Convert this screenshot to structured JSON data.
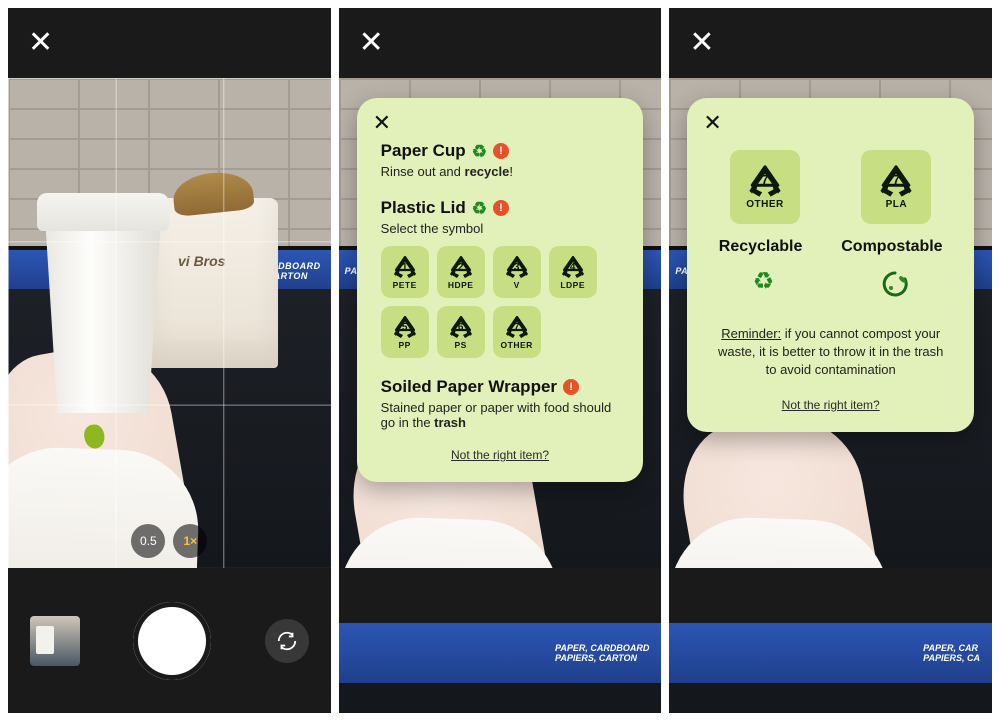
{
  "screen1": {
    "bagLogo": "vi Bros",
    "binLabelLine1": "PAPER, CARDBOARD",
    "binLabelLine2": "PAPIERS, CARTON",
    "zoom": {
      "level1": "0.5",
      "level2": "1×"
    }
  },
  "screen2": {
    "binLabel": "PAPER, CARD",
    "items": [
      {
        "title": "Paper Cup",
        "hasRecycle": true,
        "hasAlert": true,
        "sub_pre": "Rinse out and ",
        "sub_bold": "recycle",
        "sub_post": "!"
      },
      {
        "title": "Plastic Lid",
        "hasRecycle": true,
        "hasAlert": true,
        "sub_pre": "Select the symbol",
        "sub_bold": "",
        "sub_post": ""
      },
      {
        "title": "Soiled Paper Wrapper",
        "hasRecycle": false,
        "hasAlert": true,
        "sub_pre": "Stained paper or paper with food should go in the ",
        "sub_bold": "trash",
        "sub_post": ""
      }
    ],
    "symbols": [
      {
        "num": "1",
        "code": "PETE"
      },
      {
        "num": "2",
        "code": "HDPE"
      },
      {
        "num": "3",
        "code": "V"
      },
      {
        "num": "4",
        "code": "LDPE"
      },
      {
        "num": "5",
        "code": "PP"
      },
      {
        "num": "6",
        "code": "PS"
      },
      {
        "num": "7",
        "code": "OTHER"
      }
    ],
    "notRight": "Not the right item?"
  },
  "screen3": {
    "binLabelLine1": "PAPER, CAR",
    "binLabelLine2": "PAPIERS, CA",
    "symbols": [
      {
        "num": "7",
        "code": "OTHER"
      },
      {
        "num": "7",
        "code": "PLA"
      }
    ],
    "labels": {
      "left": "Recyclable",
      "right": "Compostable"
    },
    "reminder_label": "Reminder:",
    "reminder_body": " if you cannot compost your waste, it is better to throw it in the trash to avoid contamination",
    "notRight": "Not the right item?"
  },
  "glyphs": {
    "recycle": "♻",
    "alert": "!"
  }
}
